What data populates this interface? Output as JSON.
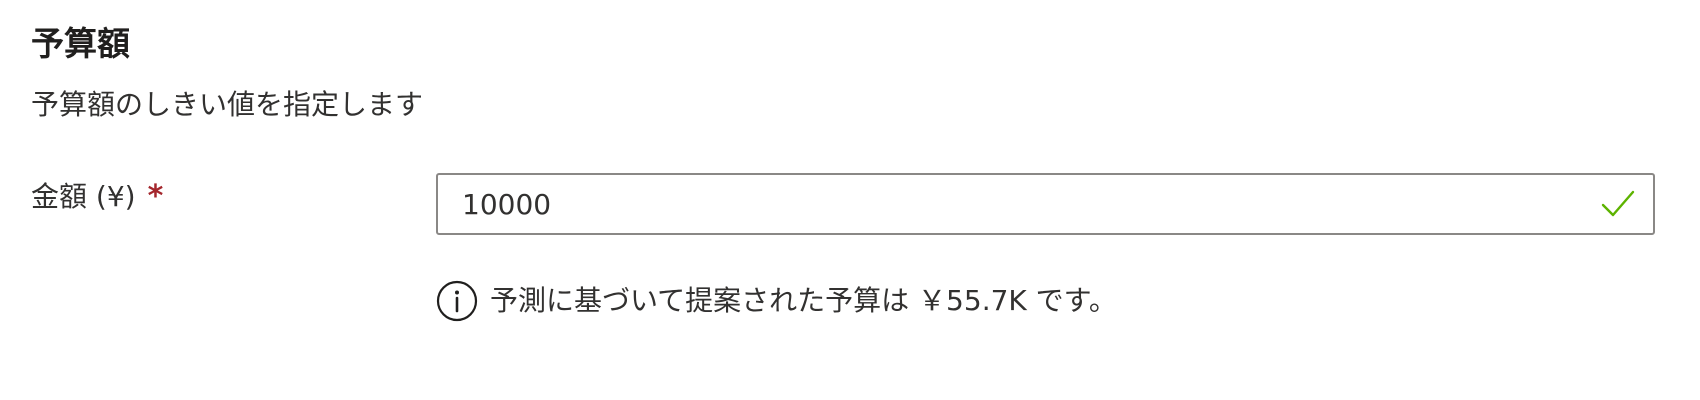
{
  "section": {
    "title": "予算額",
    "description": "予算額のしきい値を指定します"
  },
  "amount_field": {
    "label": "金額 (¥)",
    "required_marker": "*",
    "value": "10000",
    "status_icon": "checkmark-icon",
    "status_color": "#5db300"
  },
  "hint": {
    "icon": "info-icon",
    "text": "予測に基づいて提案された予算は ￥55.7K です。"
  }
}
